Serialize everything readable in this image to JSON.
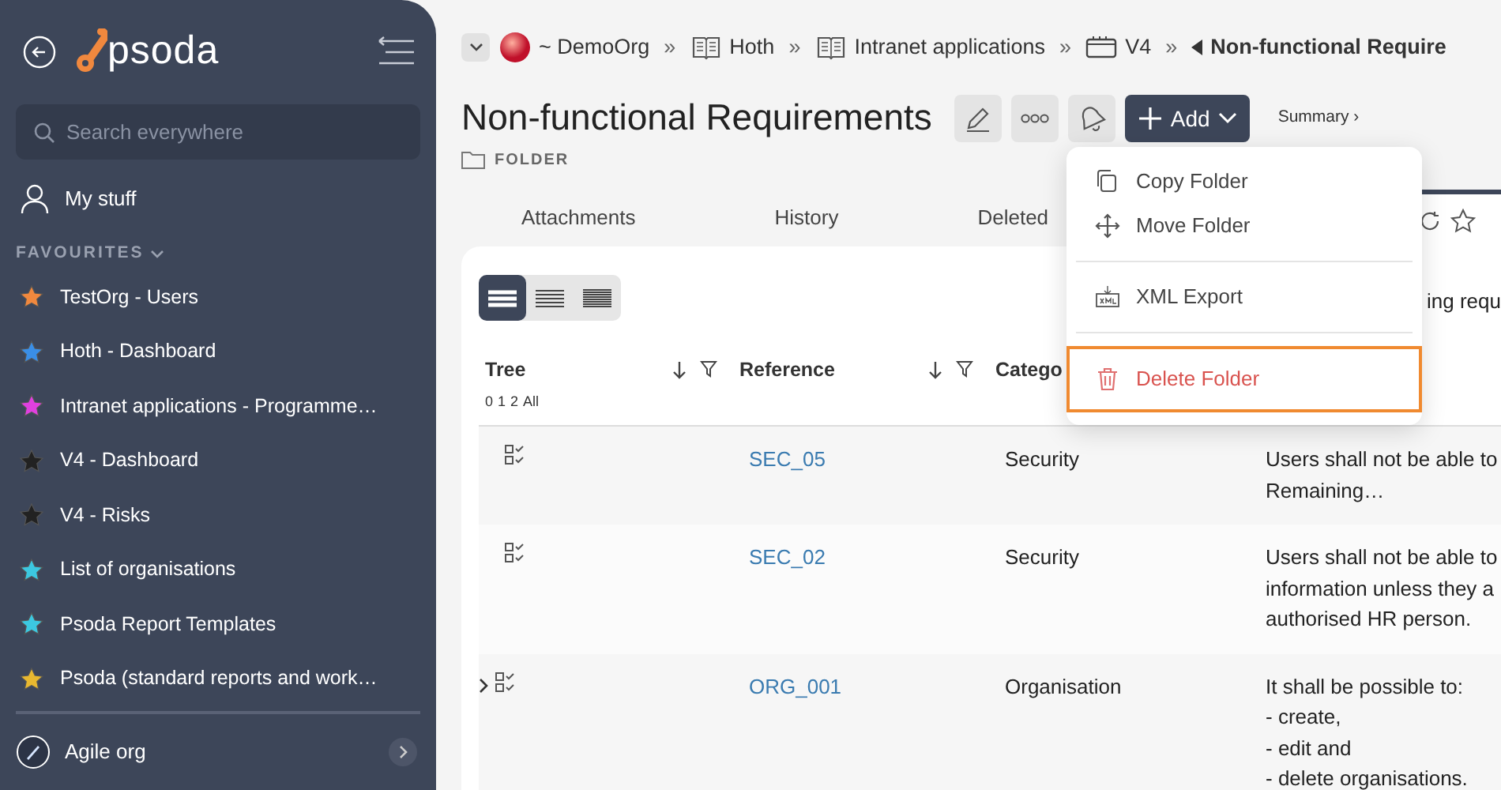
{
  "sidebar": {
    "logo": "psoda",
    "search": {
      "placeholder": "Search everywhere"
    },
    "my_stuff": "My stuff",
    "favourites_heading": "FAVOURITES",
    "favourites": [
      {
        "label": "TestOrg - Users",
        "color": "#f0883e"
      },
      {
        "label": "Hoth - Dashboard",
        "color": "#3a8ee6"
      },
      {
        "label": "Intranet applications - Programme…",
        "color": "#e040e0"
      },
      {
        "label": "V4 - Dashboard",
        "color": "#222222"
      },
      {
        "label": "V4 - Risks",
        "color": "#222222"
      },
      {
        "label": "List of organisations",
        "color": "#3cc8e0"
      },
      {
        "label": "Psoda Report Templates",
        "color": "#3cc8e0"
      },
      {
        "label": "Psoda (standard reports and work…",
        "color": "#e8b830"
      }
    ],
    "org": "Agile org"
  },
  "breadcrumb": [
    {
      "kind": "org",
      "label": "~ DemoOrg"
    },
    {
      "kind": "book",
      "label": "Hoth",
      "separator_before": "»"
    },
    {
      "kind": "book",
      "label": "Intranet applications",
      "separator_before": "»"
    },
    {
      "kind": "board",
      "label": "V4",
      "separator_before": "»"
    },
    {
      "kind": "current",
      "label": "Non-functional Require",
      "separator_before": "»"
    }
  ],
  "page": {
    "title": "Non-functional Requirements",
    "type": "FOLDER",
    "add_button": "Add",
    "summary_link": "Summary ›"
  },
  "tabs": [
    {
      "kind": "text",
      "label": "Attachments",
      "selected": false
    },
    {
      "kind": "text",
      "label": "History",
      "selected": false
    },
    {
      "kind": "text",
      "label": "Deleted",
      "selected": false
    },
    {
      "kind": "icons",
      "selected": true
    }
  ],
  "view_modes": [
    {
      "selected": true
    },
    {
      "selected": false
    },
    {
      "selected": false
    }
  ],
  "intro_text": "ing requ",
  "table": {
    "columns": [
      {
        "kind": "sortable",
        "label": "Tree",
        "levels": [
          "0",
          "1",
          "2",
          "All"
        ]
      },
      {
        "kind": "sortable",
        "label": "Reference"
      },
      {
        "kind": "plain",
        "label": "Catego"
      }
    ],
    "rows": [
      {
        "expandable": false,
        "reference": "SEC_05",
        "category": "Security",
        "description": [
          "Users shall not be able to",
          "Remaining…"
        ]
      },
      {
        "expandable": false,
        "reference": "SEC_02",
        "category": "Security",
        "description": [
          "Users shall not be able to",
          "information unless they a",
          "authorised HR person."
        ]
      },
      {
        "expandable": true,
        "reference": "ORG_001",
        "category": "Organisation",
        "description": [
          "It shall be possible to:",
          "- create,",
          "- edit and",
          "- delete organisations."
        ]
      }
    ]
  },
  "menu": {
    "items": [
      {
        "kind": "copy",
        "label": "Copy Folder",
        "danger": false,
        "highlighted": false
      },
      {
        "kind": "move",
        "label": "Move Folder",
        "danger": false,
        "highlighted": false
      },
      {
        "kind": "divider"
      },
      {
        "kind": "xml",
        "label": "XML Export",
        "danger": false,
        "highlighted": false
      },
      {
        "kind": "divider"
      },
      {
        "kind": "delete",
        "label": "Delete Folder",
        "danger": true,
        "highlighted": true
      }
    ]
  }
}
